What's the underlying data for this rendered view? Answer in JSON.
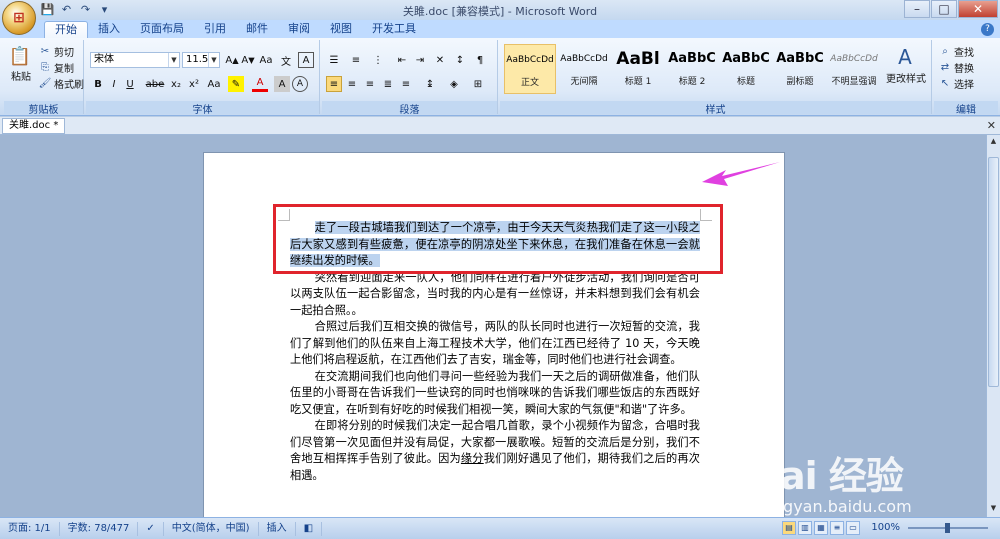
{
  "window": {
    "title": "关雎.doc [兼容模式] - Microsoft Word",
    "minimize": "–",
    "maximize": "□",
    "close": "✕"
  },
  "tabs": [
    "开始",
    "插入",
    "页面布局",
    "引用",
    "邮件",
    "审阅",
    "视图",
    "开发工具"
  ],
  "active_tab": "开始",
  "clipboard": {
    "label": "剪贴板",
    "paste": "粘贴",
    "cut": "剪切",
    "copy": "复制",
    "format_painter": "格式刷"
  },
  "font": {
    "label": "字体",
    "name": "宋体",
    "size": "11.5",
    "buttons": [
      "B",
      "I",
      "U",
      "abe",
      "x₂",
      "x²",
      "Aa",
      "A",
      "A",
      "A"
    ]
  },
  "paragraph": {
    "label": "段落"
  },
  "styles": {
    "label": "样式",
    "items": [
      {
        "sample": "AaBbCcDd",
        "name": "正文",
        "active": true
      },
      {
        "sample": "AaBbCcDd",
        "name": "无间隔",
        "active": false
      },
      {
        "sample": "AaBl",
        "name": "标题 1",
        "active": false
      },
      {
        "sample": "AaBbC",
        "name": "标题 2",
        "active": false
      },
      {
        "sample": "AaBbC",
        "name": "标题",
        "active": false
      },
      {
        "sample": "AaBbC",
        "name": "副标题",
        "active": false
      },
      {
        "sample": "AaBbCcDd",
        "name": "不明显强调",
        "active": false
      }
    ],
    "change_styles": "更改样式"
  },
  "editing": {
    "label": "编辑",
    "find": "查找",
    "replace": "替换",
    "select": "选择"
  },
  "document": {
    "tab_name": "关雎.doc *",
    "paragraphs": [
      {
        "text": "走了一段古城墙我们到达了一个凉亭，由于今天天气炎热我们走了这一小段之后大家又感到有些疲惫，便在凉亭的阴凉处坐下来休息，在我们准备在休息一会就继续出发的时候。",
        "selected": true
      },
      {
        "text": "突然看到迎面走来一队人，他们同样在进行着户外徒步活动，我们询问是否可以两支队伍一起合影留念，当时我的内心是有一丝惊讶，并未料想到我们会有机会一起拍合照。。",
        "selected": false
      },
      {
        "text": "合照过后我们互相交换的微信号，两队的队长同时也进行一次短暂的交流，我们了解到他们的队伍来自上海工程技术大学，他们在江西已经待了 10 天，今天晚上他们将启程返航，在江西他们去了吉安，瑞金等，同时他们也进行社会调查。",
        "selected": false
      },
      {
        "text": "在交流期间我们也向他们寻问一些经验为我们一天之后的调研做准备，他们队伍里的小哥哥在告诉我们一些诀窍的同时也悄咪咪的告诉我们哪些饭店的东西既好吃又便宜，在听到有好吃的时候我们相视一笑，瞬间大家的气氛便\"和谐\"了许多。",
        "selected": false
      },
      {
        "pre": "在即将分别的时候我们决定一起合唱几首歌，录个小视频作为留念，合唱时我们尽管第一次见面但并没有局促，大家都一展歌喉。短暂的交流后是分别，我们不舍地互相挥挥手告别了彼此。因为",
        "underlined": "缘分",
        "post": "我们刚好遇见了他们，期待我们之后的再次相遇。",
        "selected": false
      }
    ]
  },
  "status": {
    "page": "页面: 1/1",
    "words": "字数: 78/477",
    "language": "中文(简体，中国)",
    "mode": "插入",
    "zoom": "100%"
  },
  "watermark": {
    "logo": "Bai 经验",
    "url": "jingyan.baidu.com"
  },
  "colors": {
    "selection": "#bcd3ef",
    "annotation_box": "#e0242c",
    "annotation_arrow": "#e040e0"
  }
}
